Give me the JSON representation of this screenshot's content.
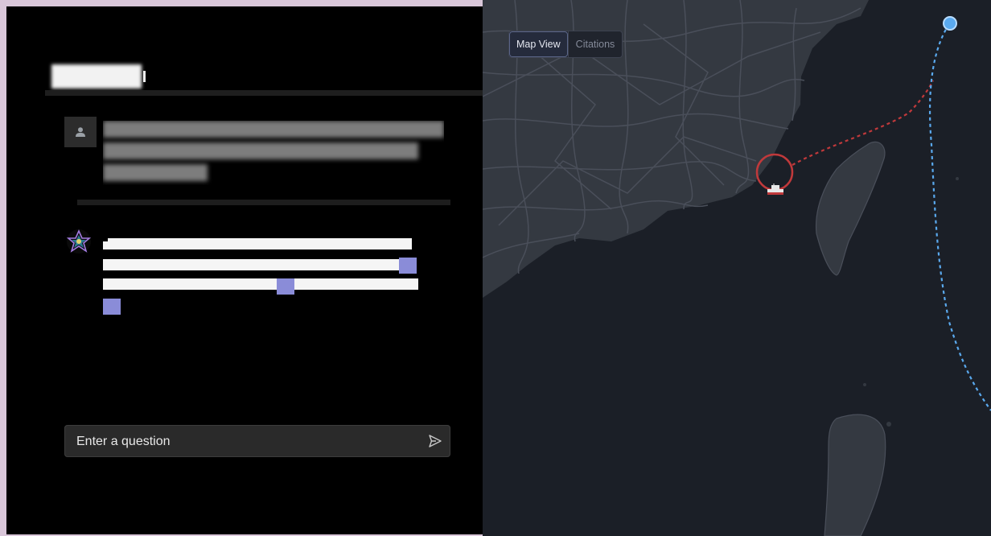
{
  "composer": {
    "placeholder": "Enter a question"
  },
  "map": {
    "tabs": [
      {
        "label": "Map View",
        "active": true
      },
      {
        "label": "Citations",
        "active": false
      }
    ]
  },
  "colors": {
    "map_background": "#1b1f27",
    "land": "#343941",
    "roads": "#4a4f5a",
    "route_red": "#c0393b",
    "route_blue": "#5aa9ee",
    "citation_badge": "#8a8cd8"
  },
  "icons": [
    "user-icon",
    "assistant-logo-icon",
    "send-icon",
    "ship-icon",
    "location-marker-icon"
  ]
}
